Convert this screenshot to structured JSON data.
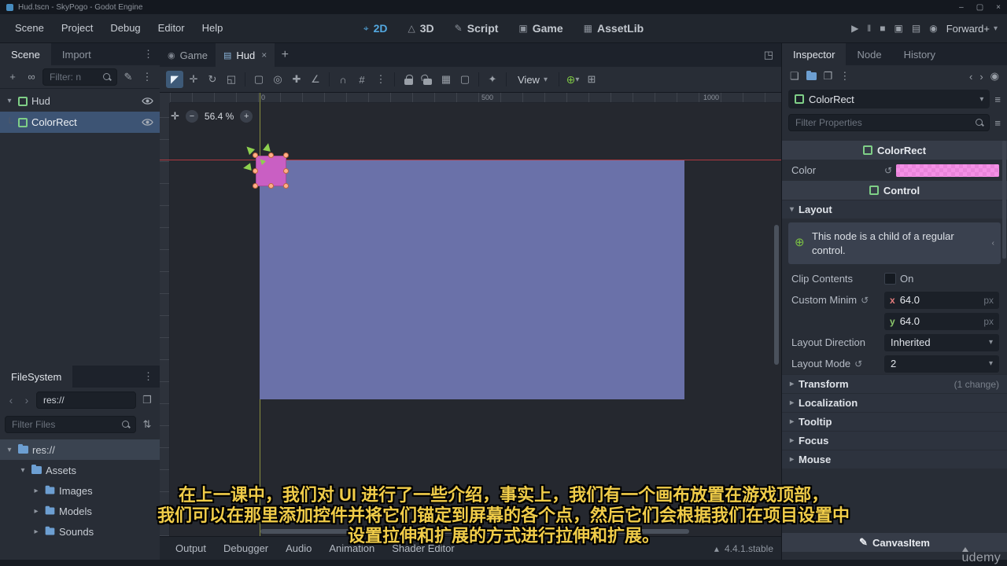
{
  "titlebar": {
    "title": "Hud.tscn - SkyPogo - Godot Engine"
  },
  "menubar": {
    "menus": [
      "Scene",
      "Project",
      "Debug",
      "Editor",
      "Help"
    ],
    "workspaces": [
      "2D",
      "3D",
      "Script",
      "Game",
      "AssetLib"
    ],
    "renderer": "Forward+"
  },
  "scene_dock": {
    "tabs": [
      "Scene",
      "Import"
    ],
    "filter_placeholder": "Filter: n",
    "nodes": [
      {
        "label": "Hud"
      },
      {
        "label": "ColorRect"
      }
    ]
  },
  "filesystem": {
    "title": "FileSystem",
    "path": "res://",
    "filter_placeholder": "Filter Files",
    "items": [
      {
        "label": "res://"
      },
      {
        "label": "Assets"
      },
      {
        "label": "Images"
      },
      {
        "label": "Models"
      },
      {
        "label": "Sounds"
      }
    ]
  },
  "viewport": {
    "tabs": [
      "Game",
      "Hud"
    ],
    "view_menu": "View",
    "zoom": "56.4 %",
    "ruler_top": [
      "0",
      "500",
      "1000"
    ]
  },
  "inspector": {
    "tabs": [
      "Inspector",
      "Node",
      "History"
    ],
    "node_name": "ColorRect",
    "filter_placeholder": "Filter Properties",
    "category_colorrect": "ColorRect",
    "color_label": "Color",
    "category_control": "Control",
    "layout_section": "Layout",
    "layout_info": "This node is a child of a regular control.",
    "clip_contents_label": "Clip Contents",
    "clip_contents_value": "On",
    "custom_minimum_label": "Custom Minim",
    "x_label": "x",
    "x_value": "64.0",
    "y_label": "y",
    "y_value": "64.0",
    "px_suffix": "px",
    "layout_direction_label": "Layout Direction",
    "layout_direction_value": "Inherited",
    "layout_mode_label": "Layout Mode",
    "layout_mode_value": "2",
    "groups": [
      "Transform",
      "Localization",
      "Tooltip",
      "Focus",
      "Mouse"
    ],
    "transform_note": "(1 change)",
    "footer_category": "CanvasItem"
  },
  "bottom_bar": {
    "tabs": [
      "Output",
      "Debugger",
      "Audio",
      "Animation",
      "Shader Editor"
    ],
    "version": "4.4.1.stable"
  },
  "watermark": "udemy",
  "subtitles": [
    "在上一课中，我们对 UI 进行了一些介绍，事实上，我们有一个画布放置在游戏顶部，",
    "我们可以在那里添加控件并将它们锚定到屏幕的各个点，然后它们会根据我们在项目设置中",
    "设置拉伸和扩展的方式进行拉伸和扩展。"
  ],
  "colors": {
    "accent_blue": "#53a8e0",
    "viewport_rect": "#6a71a9",
    "colorrect_pink": "#c95fc3",
    "subtitle_yellow": "#f0cc49",
    "guide_red": "#b13a41",
    "guide_green": "#a2a944"
  },
  "icons": {
    "minimize": "–",
    "maximize": "▢",
    "close": "×",
    "menu": "⋮",
    "chevron_down": "▾",
    "chevron_left": "‹",
    "chevron_right": "›",
    "expanded": "▾",
    "collapsed": "▸",
    "branch": "└",
    "add": "+",
    "instance_link": "∞",
    "script": "✎",
    "ws_2d": "⌖",
    "ws_3d": "△",
    "ws_script": "✎",
    "ws_game": "▣",
    "ws_assetlib": "▦",
    "play": "▶",
    "pause": "‖",
    "stop": "■",
    "remote_debug": "▣",
    "movie_mode": "▤",
    "select_tool": "◤",
    "move_tool": "✛",
    "rotate_tool": "↻",
    "scale_tool": "◱",
    "select_region": "▢",
    "pivot": "◎",
    "pan": "✚",
    "ruler": "∠",
    "smart_snap": "∩",
    "grid_snap": "#",
    "group": "▦",
    "skeleton": "✦",
    "anchor_preset": "⊕",
    "expand_anchors": "⊞",
    "viewport_expand": "◳",
    "center_view": "✛",
    "zoom_out": "−",
    "zoom_in": "+",
    "revert": "↺",
    "new_resource": "❏",
    "save_resource": "❐",
    "copy_path": "❐",
    "pin": "◉",
    "tune": "≡",
    "sort": "⇅",
    "panel_up": "▴",
    "info_anchor": "⊕",
    "canvasitem_class": "✎",
    "game_view": "◉",
    "new_tab": "+",
    "tab_close": "×"
  }
}
